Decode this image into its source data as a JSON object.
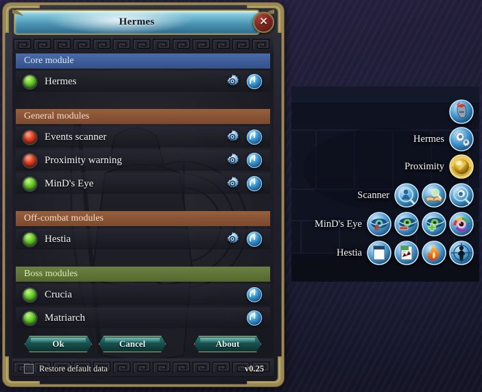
{
  "window": {
    "title": "Hermes",
    "close_icon": "close-x-icon"
  },
  "sections": [
    {
      "id": "core",
      "header": "Core module",
      "color": "#33518a",
      "rows": [
        {
          "label": "Hermes",
          "led": "green",
          "gear": true,
          "power": true
        }
      ]
    },
    {
      "id": "general",
      "header": "General modules",
      "color": "#7c4a2e",
      "rows": [
        {
          "label": "Events scanner",
          "led": "red",
          "gear": true,
          "power": true
        },
        {
          "label": "Proximity warning",
          "led": "red",
          "gear": true,
          "power": true
        },
        {
          "label": "MinD's Eye",
          "led": "green",
          "gear": true,
          "power": true
        }
      ]
    },
    {
      "id": "offcombat",
      "header": "Off-combat modules",
      "color": "#7c4a2e",
      "rows": [
        {
          "label": "Hestia",
          "led": "green",
          "gear": true,
          "power": true
        }
      ]
    },
    {
      "id": "boss",
      "header": "Boss modules",
      "color": "#54682f",
      "rows": [
        {
          "label": "Crucia",
          "led": "green",
          "gear": false,
          "power": true
        },
        {
          "label": "Matriarch",
          "led": "green",
          "gear": false,
          "power": true
        }
      ]
    }
  ],
  "footer": {
    "ok_label": "Ok",
    "cancel_label": "Cancel",
    "about_label": "About",
    "restore_label": "Restore default data",
    "restore_checked": false,
    "version": "v0.25"
  },
  "radial_menu": {
    "rows": [
      {
        "label": "",
        "icons": [
          "helmet-icon"
        ]
      },
      {
        "label": "Hermes",
        "icons": [
          "gears-icon"
        ]
      },
      {
        "label": "Proximity",
        "icons": [
          "golden-orb-icon"
        ]
      },
      {
        "label": "Scanner",
        "icons": [
          "person-search-icon",
          "book-search-icon",
          "gear-search-icon"
        ]
      },
      {
        "label": "MinD's Eye",
        "icons": [
          "eye-marker-icon",
          "eye-bar-icon",
          "eye-plus-icon",
          "eye-rainbow-icon"
        ]
      },
      {
        "label": "Hestia",
        "icons": [
          "document-icon",
          "report-icon",
          "flame-icon",
          "figure-target-icon"
        ]
      }
    ]
  },
  "colors": {
    "frame_gold": "#9a8a52",
    "title_cyan": "#7fc6d9",
    "led_green": "#66cc27",
    "led_red": "#e0401f",
    "button_teal": "#17524f",
    "icon_blue": "#2f8fd0"
  }
}
